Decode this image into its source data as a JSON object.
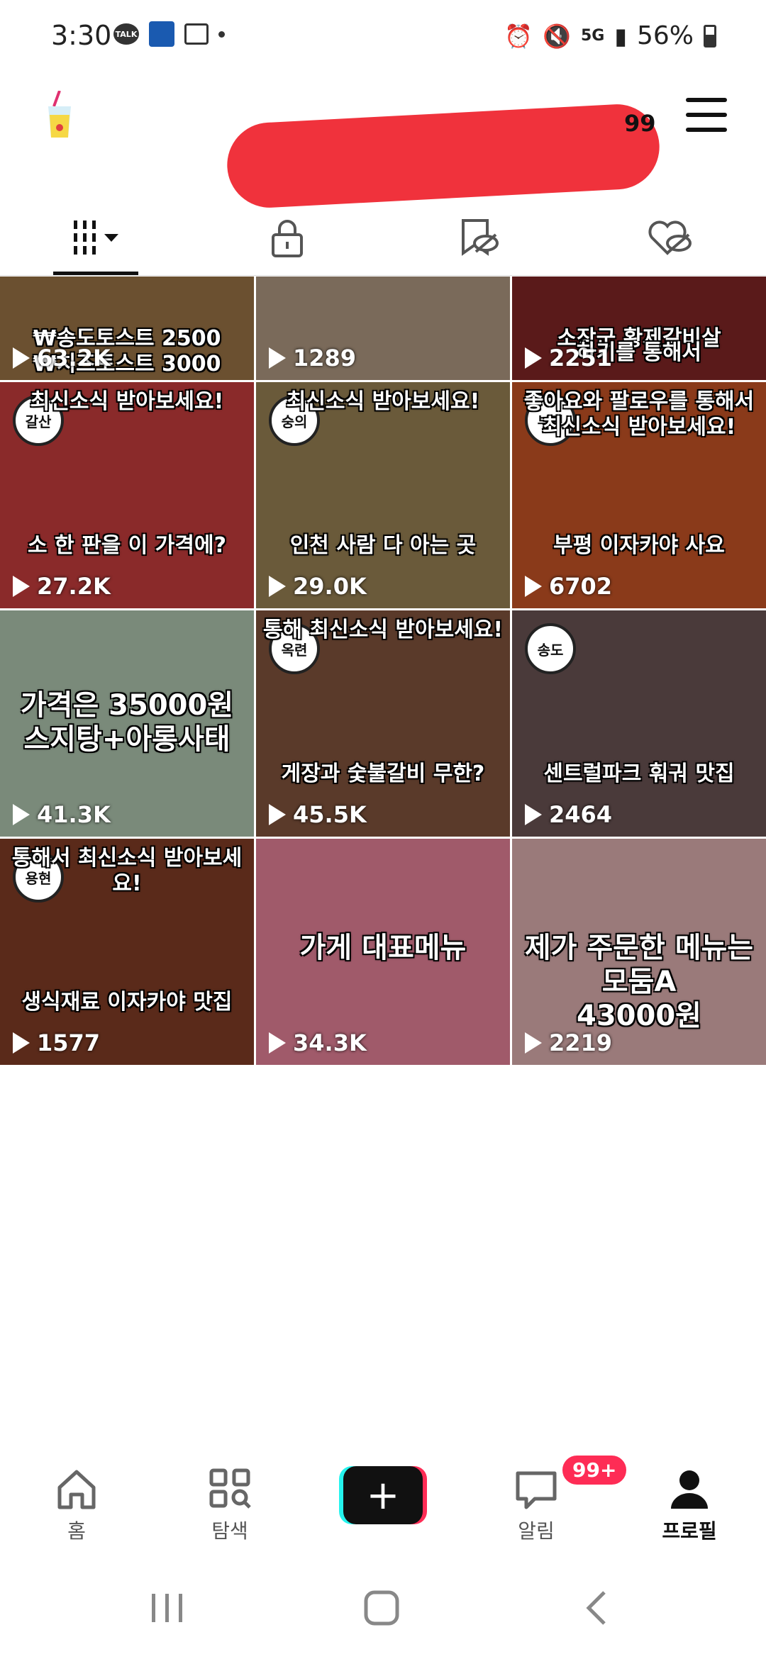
{
  "status_bar": {
    "time": "3:30",
    "talk_label": "TALK",
    "network_label": "5G",
    "battery": "56%"
  },
  "header": {
    "username_visible_fragment": "99"
  },
  "tabs": [
    {
      "name": "videos",
      "icon": "grid-icon"
    },
    {
      "name": "private",
      "icon": "lock-icon"
    },
    {
      "name": "saved",
      "icon": "bookmark-hidden-icon"
    },
    {
      "name": "liked",
      "icon": "heart-hidden-icon"
    }
  ],
  "videos": [
    {
      "views": "63.2K",
      "top_text": "₩송도토스트 2500\n₩치즈토스트 3000",
      "bottom_text": "",
      "badge": "",
      "bg": "#6b5030"
    },
    {
      "views": "1289",
      "top_text": "",
      "bottom_text": "",
      "badge": "",
      "bg": "#7a6a5a"
    },
    {
      "views": "2251",
      "top_text": "소장군 황제갈비살",
      "bottom_text": "하기를 통해서",
      "badge": "",
      "bg": "#5a1a1a"
    },
    {
      "views": "27.2K",
      "top_text": "최신소식 받아보세요!",
      "bottom_text": "소 한 판을 이 가격에?",
      "badge": "갈산",
      "bg": "#8a2a2a"
    },
    {
      "views": "29.0K",
      "top_text": "최신소식 받아보세요!",
      "bottom_text": "인천 사람 다 아는 곳",
      "badge": "숭의",
      "bg": "#6a5a3a"
    },
    {
      "views": "6702",
      "top_text": "좋아요와 팔로우를 통해서\n최신소식 받아보세요!",
      "bottom_text": "부평 이자카야 사요",
      "badge": "부평",
      "bg": "#8a3a1a"
    },
    {
      "views": "41.3K",
      "top_text": "가격은 35000원\n스지탕+아롱사태",
      "bottom_text": "",
      "badge": "",
      "bg": "#7a8a7a"
    },
    {
      "views": "45.5K",
      "top_text": "통해 최신소식 받아보세요!",
      "bottom_text": "게장과 숯불갈비 무한?",
      "badge": "옥련",
      "bg": "#5a3a2a"
    },
    {
      "views": "2464",
      "top_text": "",
      "bottom_text": "센트럴파크 훠궈 맛집",
      "badge": "송도",
      "bg": "#4a3a3a"
    },
    {
      "views": "1577",
      "top_text": "통해서 최신소식 받아보세요!",
      "bottom_text": "생식재료 이자카야 맛집",
      "badge": "용현",
      "bg": "#5a2a1a"
    },
    {
      "views": "34.3K",
      "top_text": "가게 대표메뉴",
      "bottom_text": "",
      "badge": "",
      "bg": "#a05a6a"
    },
    {
      "views": "2219",
      "top_text": "제가 주문한 메뉴는 모둠A\n43000원",
      "bottom_text": "",
      "badge": "",
      "bg": "#9a7a7a"
    }
  ],
  "bottom_nav": {
    "home": "홈",
    "explore": "탐색",
    "inbox": "알림",
    "inbox_badge": "99+",
    "profile": "프로필"
  }
}
